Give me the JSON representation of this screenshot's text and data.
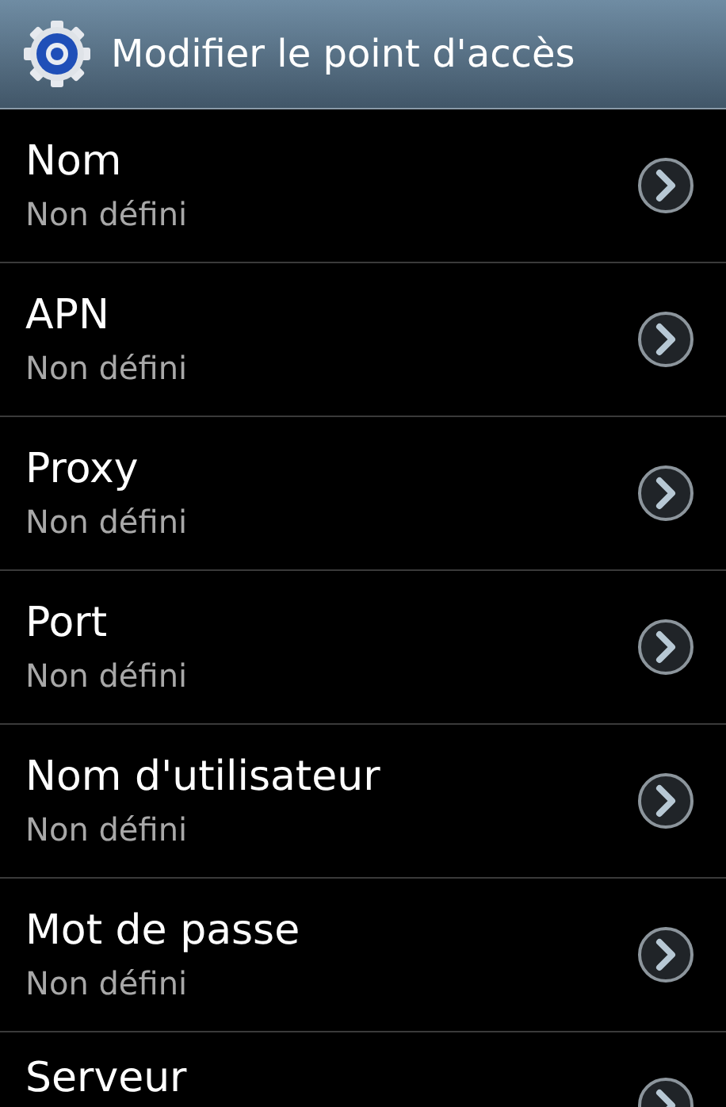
{
  "title_bar": {
    "title": "Modifier le point d'accès"
  },
  "items": [
    {
      "label": "Nom",
      "value": "Non défini"
    },
    {
      "label": "APN",
      "value": "Non défini"
    },
    {
      "label": "Proxy",
      "value": "Non défini"
    },
    {
      "label": "Port",
      "value": "Non défini"
    },
    {
      "label": "Nom d'utilisateur",
      "value": "Non défini"
    },
    {
      "label": "Mot de passe",
      "value": "Non défini"
    },
    {
      "label": "Serveur"
    }
  ]
}
